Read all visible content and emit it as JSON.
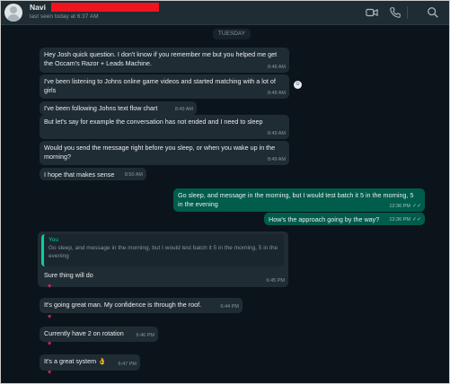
{
  "header": {
    "contact_name": "Navi",
    "last_seen": "last seen today at 6:37 AM"
  },
  "chat": {
    "day_label": "TUESDAY",
    "messages": [
      {
        "text": "Hey Josh quick question. I don't know if you remember me but you helped me get the Occam's Razor + Leads Machine.",
        "time": "8:48 AM"
      },
      {
        "text": "I've been listening to Johns online game videos and started matching with a lot of girls",
        "time": "8:48 AM"
      },
      {
        "text": "I've been following Johns text flow chart",
        "time": "8:49 AM"
      },
      {
        "text": "But let's say for example the conversation has not ended and I need to sleep",
        "time": "8:49 AM"
      },
      {
        "text": "Would you send the message right before you sleep, or when you wake up in the morning?",
        "time": "8:49 AM"
      },
      {
        "text": "I hope that makes sense",
        "time": "8:50 AM"
      },
      {
        "text": "Go sleep, and message in the morning, but I would test batch it 5 in the morning, 5 in the evening",
        "time": "12:36 PM"
      },
      {
        "text": "How's the approach going by the way?",
        "time": "12:36 PM"
      },
      {
        "text": "Sure thing will do",
        "time": "6:45 PM"
      },
      {
        "text": "It's going great man. My confidence is through the roof.",
        "time": "6:44 PM"
      },
      {
        "text": "Currently have 2 on rotation",
        "time": "6:46 PM"
      },
      {
        "text": "It's a great system 👌",
        "time": "6:47 PM"
      }
    ],
    "quote": {
      "author": "You",
      "text": "Go sleep, and message in the morning, but I would test batch it 5 in the morning, 5 in the evening"
    },
    "reaction": "♥",
    "read_mark": "✓✓"
  },
  "colors": {
    "background": "#0b141a",
    "incoming_bubble": "#202c33",
    "outgoing_bubble": "#005c4b",
    "accent": "#06cf9c",
    "redaction": "#f0141e"
  },
  "icons": [
    "video-call-icon",
    "voice-call-icon",
    "search-icon",
    "emoji-reaction-icon"
  ]
}
